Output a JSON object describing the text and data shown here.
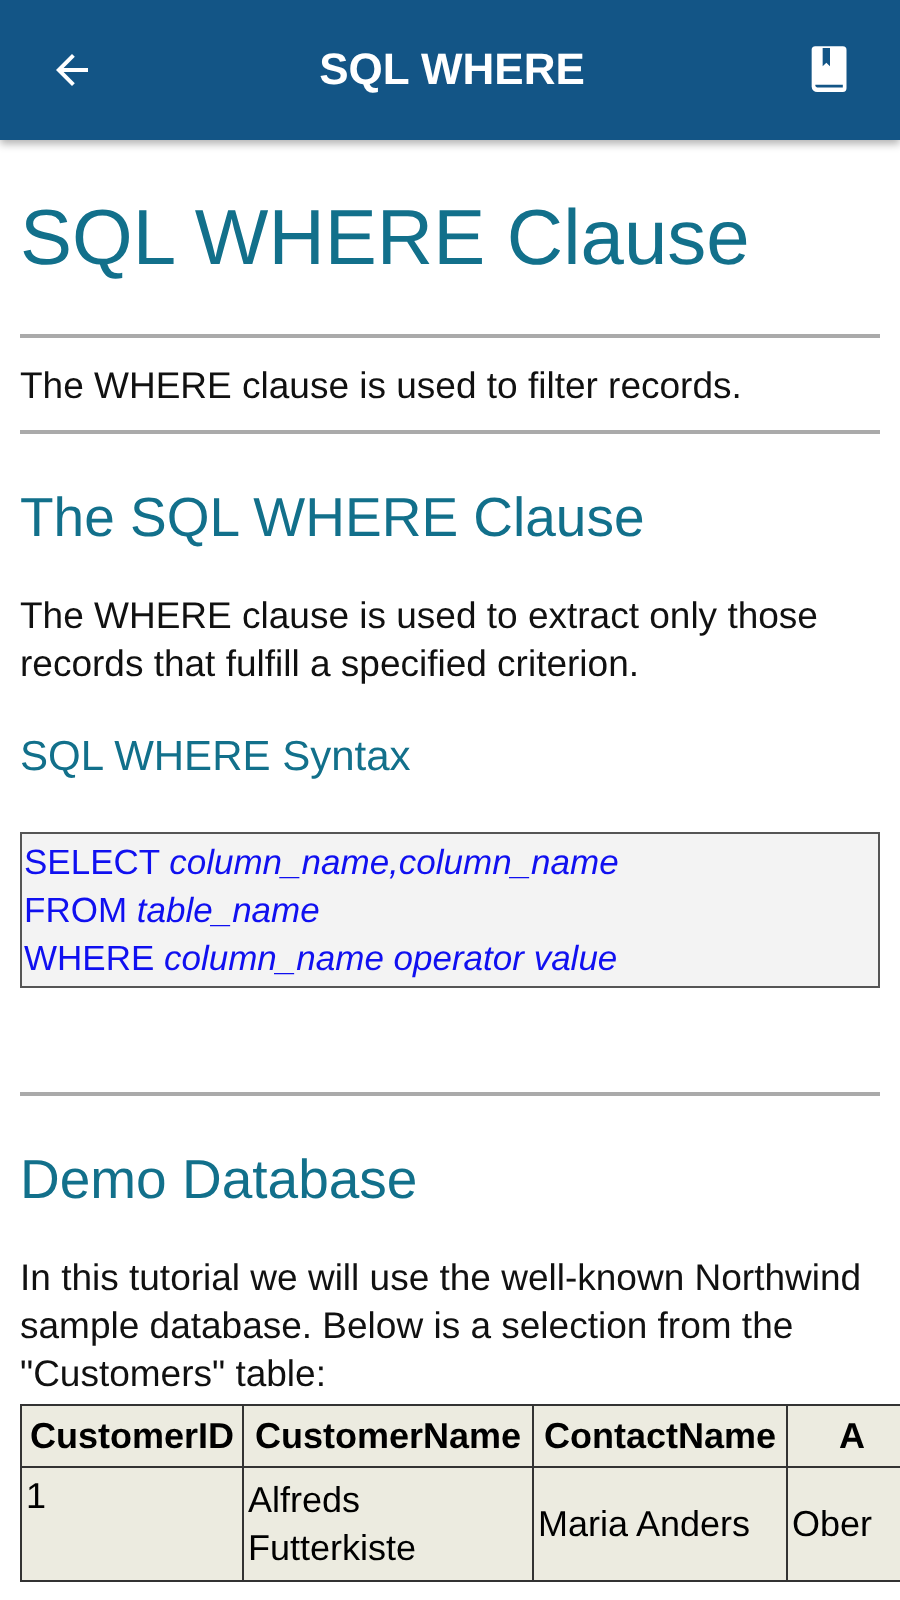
{
  "app_bar": {
    "title": "SQL WHERE"
  },
  "heading": "SQL WHERE Clause",
  "intro": "The WHERE clause is used to filter records.",
  "section": {
    "heading": "The SQL WHERE Clause",
    "text": "The WHERE clause is used to extract only those records that fulfill a specified criterion."
  },
  "syntax": {
    "heading": "SQL WHERE Syntax",
    "lines": [
      "SELECT *column_name,column_name*",
      "FROM *table_name*",
      "WHERE *column_name operator value*"
    ]
  },
  "demo": {
    "heading": "Demo Database",
    "text": "In this tutorial we will use the well-known Northwind sample database. Below is a selection from the \"Customers\" table:"
  },
  "table": {
    "columns": [
      "CustomerID",
      "CustomerName",
      "ContactName",
      "A"
    ],
    "rows": [
      [
        "1",
        "Alfreds Futterkiste",
        "Maria Anders",
        "Ober"
      ]
    ]
  }
}
